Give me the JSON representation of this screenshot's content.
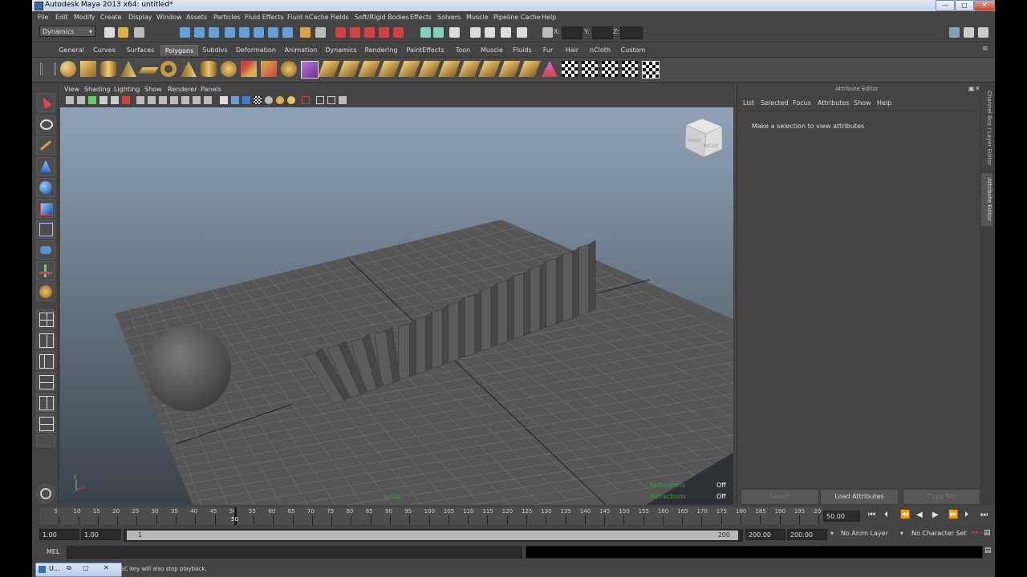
{
  "window": {
    "title": "Autodesk Maya 2013 x64: untitled*"
  },
  "menubar": [
    "File",
    "Edit",
    "Modify",
    "Create",
    "Display",
    "Window",
    "Assets",
    "Particles",
    "Fluid Effects",
    "Fluid nCache",
    "Fields",
    "Soft/Rigid Bodies",
    "Effects",
    "Solvers",
    "Muscle",
    "Pipeline Cache",
    "Help"
  ],
  "status_line": {
    "menu_set": "Dynamics",
    "x_label": "X:",
    "y_label": "Y:",
    "z_label": "Z:"
  },
  "shelf_tabs": [
    "General",
    "Curves",
    "Surfaces",
    "Polygons",
    "Subdivs",
    "Deformation",
    "Animation",
    "Dynamics",
    "Rendering",
    "PaintEffects",
    "Toon",
    "Muscle",
    "Fluids",
    "Fur",
    "Hair",
    "nCloth",
    "Custom"
  ],
  "active_shelf_tab": "Polygons",
  "panel_menu": [
    "View",
    "Shading",
    "Lighting",
    "Show",
    "Renderer",
    "Panels"
  ],
  "viewport": {
    "camera_label": "persp",
    "view_cube_right": "RIGHT",
    "view_cube_front": "FRONT",
    "hud_reflections": "Reflections",
    "hud_reflections_val": "Off",
    "hud_row2": "Refractions",
    "hud_row2_val": "Off"
  },
  "attribute_editor": {
    "title": "Attribute Editor",
    "menu": [
      "List",
      "Selected",
      "Focus",
      "Attributes",
      "Show",
      "Help"
    ],
    "message": "Make a selection to view attributes",
    "buttons": {
      "select": "Select",
      "load": "Load Attributes",
      "copy": "Copy Tab"
    }
  },
  "side_tabs": {
    "channel_box": "Channel Box / Layer Editor",
    "attribute_editor": "Attribute Editor"
  },
  "time_slider": {
    "ticks": [
      "5",
      "10",
      "15",
      "20",
      "25",
      "30",
      "35",
      "40",
      "45",
      "50",
      "55",
      "60",
      "65",
      "70",
      "75",
      "80",
      "85",
      "90",
      "95",
      "100",
      "105",
      "110",
      "115",
      "120",
      "125",
      "130",
      "135",
      "140",
      "145",
      "150",
      "155",
      "160",
      "165",
      "170",
      "175",
      "180",
      "185",
      "190",
      "195",
      "20"
    ],
    "current_frame": "50",
    "current_time": "50.00"
  },
  "range_slider": {
    "start_time": "1.00",
    "playback_start": "1.00",
    "range_start": "1",
    "range_end": "200",
    "playback_end": "200.00",
    "end_time": "200.00",
    "anim_layer": "No Anim Layer",
    "character_set": "No Character Set"
  },
  "command_line": {
    "label": "MEL"
  },
  "help_line": {
    "text": "ESC key will also stop playback.",
    "taskbar_label": "U..."
  },
  "colors": {
    "ui_bg": "#444444",
    "viewport_top": "#8fa3b9",
    "viewport_bottom": "#3a4249",
    "grid": "#6e6e6e",
    "titlebar": "#c8d9ee"
  }
}
